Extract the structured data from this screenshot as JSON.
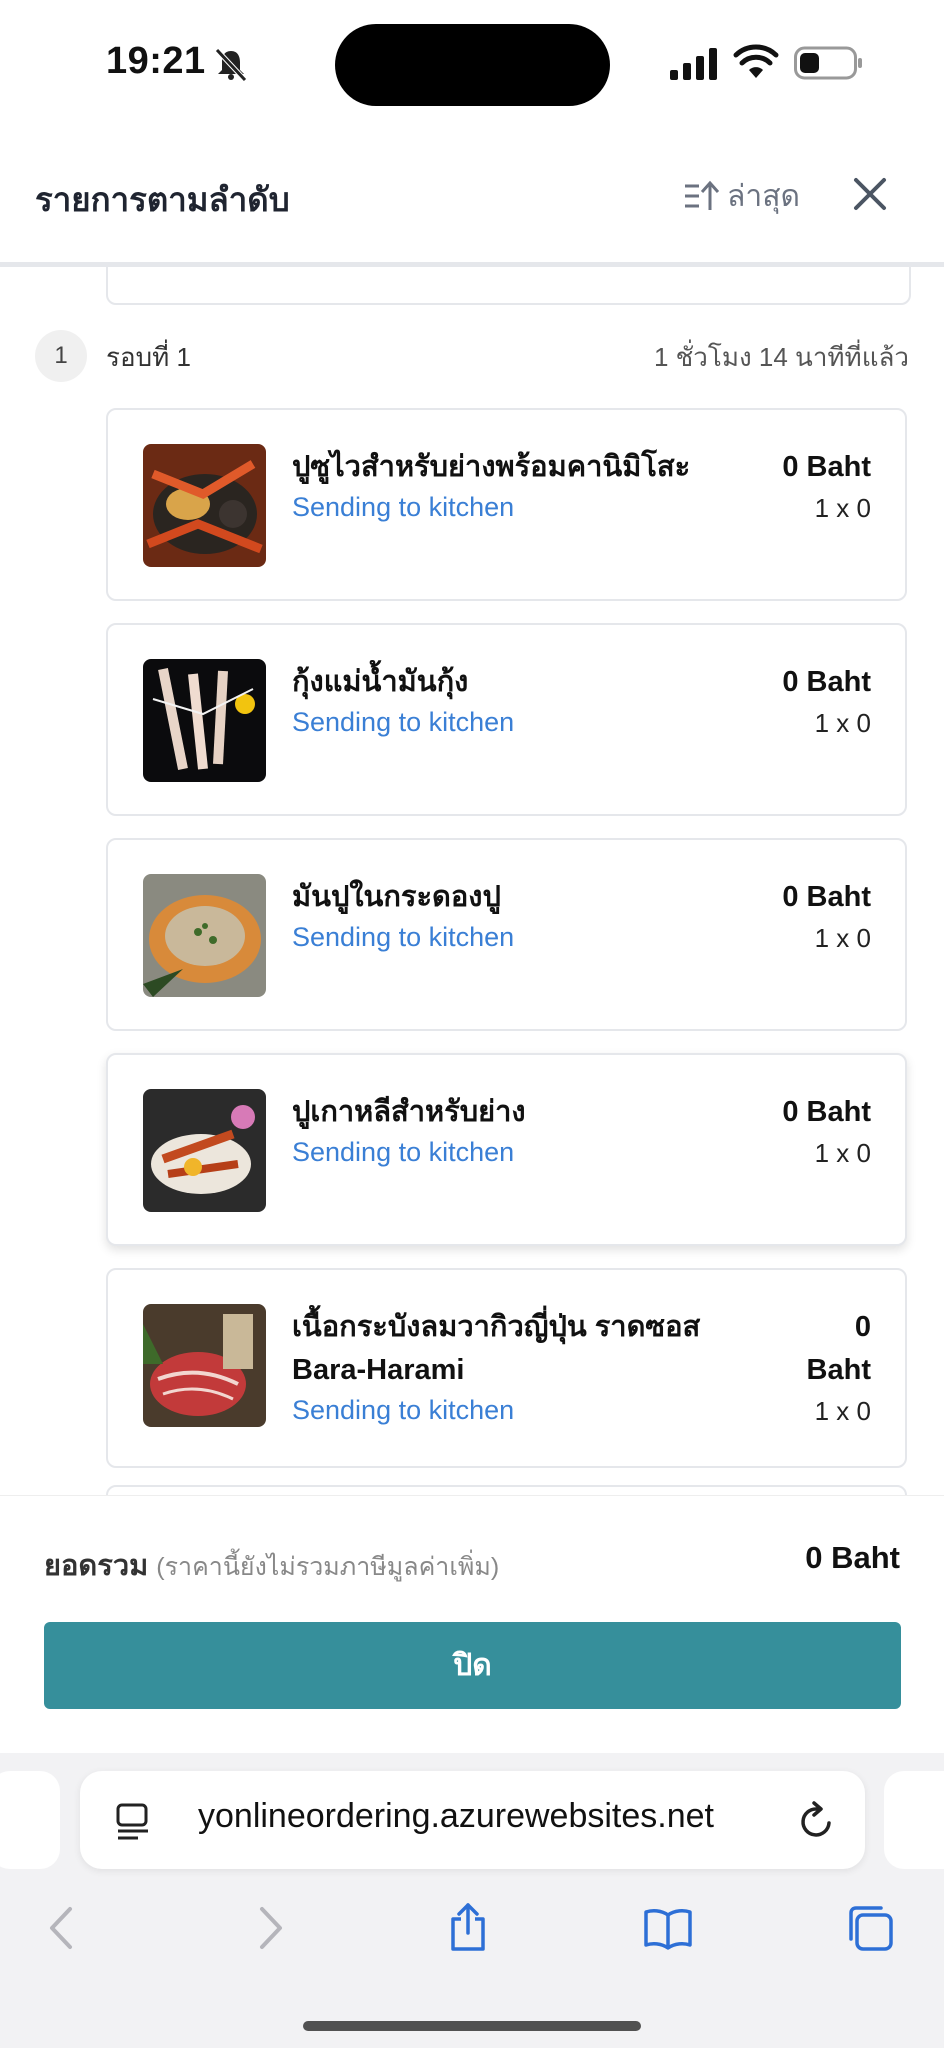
{
  "status_bar": {
    "time": "19:21"
  },
  "header": {
    "title": "รายการตามลำดับ",
    "sort_label": "ล่าสุด"
  },
  "round": {
    "number": "1",
    "label": "รอบที่ 1",
    "time_ago": "1 ชั่วโมง 14 นาทีที่แล้ว"
  },
  "items": [
    {
      "name": "ปูซูไวสำหรับย่างพร้อมคานิมิโสะ",
      "status": "Sending to kitchen",
      "price": "0 Baht",
      "qty": "1 x 0"
    },
    {
      "name": "กุ้งแม่น้ำมันกุ้ง",
      "status": "Sending to kitchen",
      "price": "0 Baht",
      "qty": "1 x 0"
    },
    {
      "name": "มันปูในกระดองปู",
      "status": "Sending to kitchen",
      "price": "0 Baht",
      "qty": "1 x 0"
    },
    {
      "name": "ปูเกาหลีสำหรับย่าง",
      "status": "Sending to kitchen",
      "price": "0 Baht",
      "qty": "1 x 0"
    },
    {
      "name": "เนื้อกระบังลมวากิวญี่ปุ่น ราดซอส Bara-Harami",
      "status": "Sending to kitchen",
      "price_num": "0",
      "price_unit": "Baht",
      "qty": "1 x 0"
    }
  ],
  "footer": {
    "total_label": "ยอดรวม",
    "total_note": "(ราคานี้ยังไม่รวมภาษีมูลค่าเพิ่ม)",
    "total_value": "0 Baht",
    "close_button": "ปิด"
  },
  "browser": {
    "url": "yonlineordering.azurewebsites.net"
  },
  "colors": {
    "accent": "#368f9b",
    "status_blue": "#3a7fd5"
  }
}
